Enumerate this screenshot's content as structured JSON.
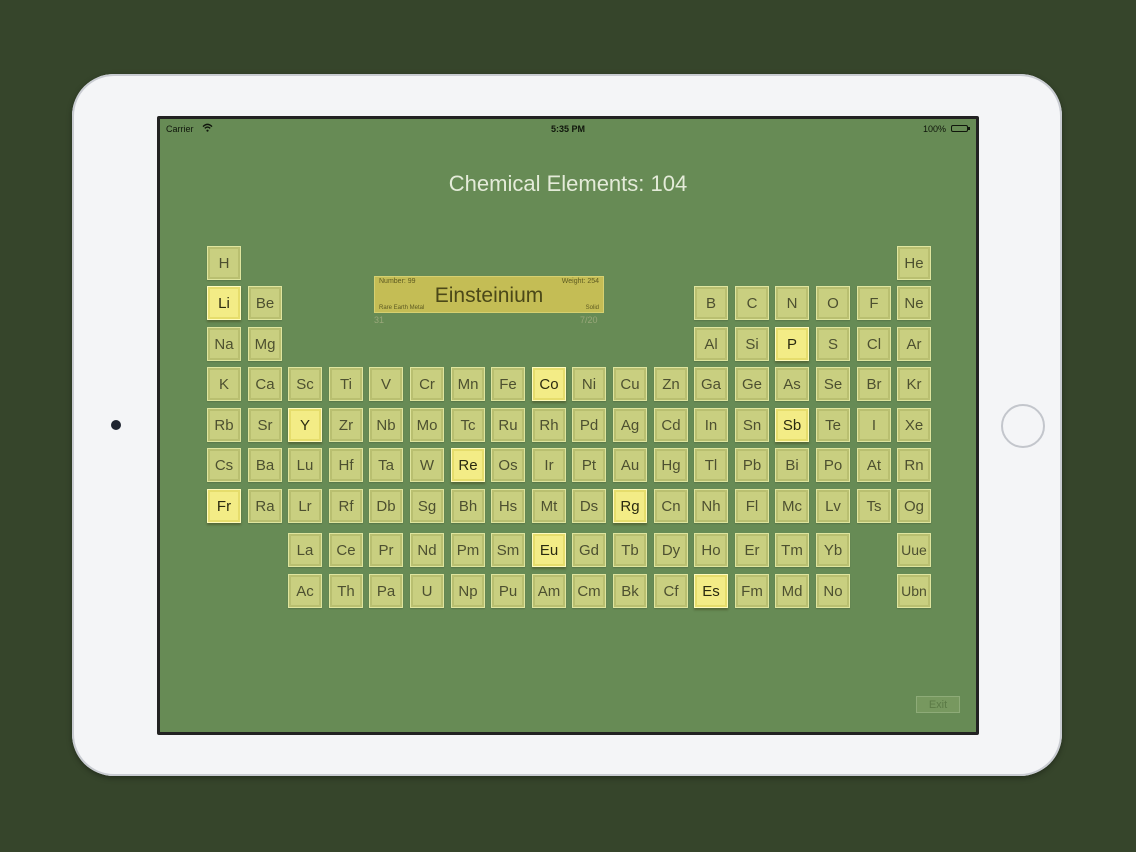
{
  "status_bar": {
    "carrier": "Carrier",
    "time": "5:35 PM",
    "battery": "100%"
  },
  "title": "Chemical Elements: 104",
  "info_card": {
    "number": "Number: 99",
    "weight": "Weight: 254",
    "name": "Einsteinium",
    "category": "Rare Earth Metal",
    "state": "Solid",
    "left_count": "31",
    "right_count": "7/20"
  },
  "exit_label": "Exit",
  "colors": {
    "background": "#678b55",
    "tile": "#c9cf80",
    "tile_highlight": "#f3ec86"
  },
  "elements": [
    {
      "s": "H",
      "r": 0,
      "c": 0
    },
    {
      "s": "He",
      "r": 0,
      "c": 17
    },
    {
      "s": "Li",
      "r": 1,
      "c": 0,
      "hl": true
    },
    {
      "s": "Be",
      "r": 1,
      "c": 1
    },
    {
      "s": "B",
      "r": 1,
      "c": 12
    },
    {
      "s": "C",
      "r": 1,
      "c": 13
    },
    {
      "s": "N",
      "r": 1,
      "c": 14
    },
    {
      "s": "O",
      "r": 1,
      "c": 15
    },
    {
      "s": "F",
      "r": 1,
      "c": 16
    },
    {
      "s": "Ne",
      "r": 1,
      "c": 17
    },
    {
      "s": "Na",
      "r": 2,
      "c": 0
    },
    {
      "s": "Mg",
      "r": 2,
      "c": 1
    },
    {
      "s": "Al",
      "r": 2,
      "c": 12
    },
    {
      "s": "Si",
      "r": 2,
      "c": 13
    },
    {
      "s": "P",
      "r": 2,
      "c": 14,
      "hl": true
    },
    {
      "s": "S",
      "r": 2,
      "c": 15
    },
    {
      "s": "Cl",
      "r": 2,
      "c": 16
    },
    {
      "s": "Ar",
      "r": 2,
      "c": 17
    },
    {
      "s": "K",
      "r": 3,
      "c": 0
    },
    {
      "s": "Ca",
      "r": 3,
      "c": 1
    },
    {
      "s": "Sc",
      "r": 3,
      "c": 2
    },
    {
      "s": "Ti",
      "r": 3,
      "c": 3
    },
    {
      "s": "V",
      "r": 3,
      "c": 4
    },
    {
      "s": "Cr",
      "r": 3,
      "c": 5
    },
    {
      "s": "Mn",
      "r": 3,
      "c": 6
    },
    {
      "s": "Fe",
      "r": 3,
      "c": 7
    },
    {
      "s": "Co",
      "r": 3,
      "c": 8,
      "hl": true
    },
    {
      "s": "Ni",
      "r": 3,
      "c": 9
    },
    {
      "s": "Cu",
      "r": 3,
      "c": 10
    },
    {
      "s": "Zn",
      "r": 3,
      "c": 11
    },
    {
      "s": "Ga",
      "r": 3,
      "c": 12
    },
    {
      "s": "Ge",
      "r": 3,
      "c": 13
    },
    {
      "s": "As",
      "r": 3,
      "c": 14
    },
    {
      "s": "Se",
      "r": 3,
      "c": 15
    },
    {
      "s": "Br",
      "r": 3,
      "c": 16
    },
    {
      "s": "Kr",
      "r": 3,
      "c": 17
    },
    {
      "s": "Rb",
      "r": 4,
      "c": 0
    },
    {
      "s": "Sr",
      "r": 4,
      "c": 1
    },
    {
      "s": "Y",
      "r": 4,
      "c": 2,
      "hl": true
    },
    {
      "s": "Zr",
      "r": 4,
      "c": 3
    },
    {
      "s": "Nb",
      "r": 4,
      "c": 4
    },
    {
      "s": "Mo",
      "r": 4,
      "c": 5
    },
    {
      "s": "Tc",
      "r": 4,
      "c": 6
    },
    {
      "s": "Ru",
      "r": 4,
      "c": 7
    },
    {
      "s": "Rh",
      "r": 4,
      "c": 8
    },
    {
      "s": "Pd",
      "r": 4,
      "c": 9
    },
    {
      "s": "Ag",
      "r": 4,
      "c": 10
    },
    {
      "s": "Cd",
      "r": 4,
      "c": 11
    },
    {
      "s": "In",
      "r": 4,
      "c": 12
    },
    {
      "s": "Sn",
      "r": 4,
      "c": 13
    },
    {
      "s": "Sb",
      "r": 4,
      "c": 14,
      "hl": true
    },
    {
      "s": "Te",
      "r": 4,
      "c": 15
    },
    {
      "s": "I",
      "r": 4,
      "c": 16
    },
    {
      "s": "Xe",
      "r": 4,
      "c": 17
    },
    {
      "s": "Cs",
      "r": 5,
      "c": 0
    },
    {
      "s": "Ba",
      "r": 5,
      "c": 1
    },
    {
      "s": "Lu",
      "r": 5,
      "c": 2
    },
    {
      "s": "Hf",
      "r": 5,
      "c": 3
    },
    {
      "s": "Ta",
      "r": 5,
      "c": 4
    },
    {
      "s": "W",
      "r": 5,
      "c": 5
    },
    {
      "s": "Re",
      "r": 5,
      "c": 6,
      "hl": true
    },
    {
      "s": "Os",
      "r": 5,
      "c": 7
    },
    {
      "s": "Ir",
      "r": 5,
      "c": 8
    },
    {
      "s": "Pt",
      "r": 5,
      "c": 9
    },
    {
      "s": "Au",
      "r": 5,
      "c": 10
    },
    {
      "s": "Hg",
      "r": 5,
      "c": 11
    },
    {
      "s": "Tl",
      "r": 5,
      "c": 12
    },
    {
      "s": "Pb",
      "r": 5,
      "c": 13
    },
    {
      "s": "Bi",
      "r": 5,
      "c": 14
    },
    {
      "s": "Po",
      "r": 5,
      "c": 15
    },
    {
      "s": "At",
      "r": 5,
      "c": 16
    },
    {
      "s": "Rn",
      "r": 5,
      "c": 17
    },
    {
      "s": "Fr",
      "r": 6,
      "c": 0,
      "hl": true
    },
    {
      "s": "Ra",
      "r": 6,
      "c": 1
    },
    {
      "s": "Lr",
      "r": 6,
      "c": 2
    },
    {
      "s": "Rf",
      "r": 6,
      "c": 3
    },
    {
      "s": "Db",
      "r": 6,
      "c": 4
    },
    {
      "s": "Sg",
      "r": 6,
      "c": 5
    },
    {
      "s": "Bh",
      "r": 6,
      "c": 6
    },
    {
      "s": "Hs",
      "r": 6,
      "c": 7
    },
    {
      "s": "Mt",
      "r": 6,
      "c": 8
    },
    {
      "s": "Ds",
      "r": 6,
      "c": 9
    },
    {
      "s": "Rg",
      "r": 6,
      "c": 10,
      "hl": true
    },
    {
      "s": "Cn",
      "r": 6,
      "c": 11
    },
    {
      "s": "Nh",
      "r": 6,
      "c": 12
    },
    {
      "s": "Fl",
      "r": 6,
      "c": 13
    },
    {
      "s": "Mc",
      "r": 6,
      "c": 14
    },
    {
      "s": "Lv",
      "r": 6,
      "c": 15
    },
    {
      "s": "Ts",
      "r": 6,
      "c": 16
    },
    {
      "s": "Og",
      "r": 6,
      "c": 17
    },
    {
      "s": "La",
      "r": 7,
      "c": 2
    },
    {
      "s": "Ce",
      "r": 7,
      "c": 3
    },
    {
      "s": "Pr",
      "r": 7,
      "c": 4
    },
    {
      "s": "Nd",
      "r": 7,
      "c": 5
    },
    {
      "s": "Pm",
      "r": 7,
      "c": 6
    },
    {
      "s": "Sm",
      "r": 7,
      "c": 7
    },
    {
      "s": "Eu",
      "r": 7,
      "c": 8,
      "hl": true
    },
    {
      "s": "Gd",
      "r": 7,
      "c": 9
    },
    {
      "s": "Tb",
      "r": 7,
      "c": 10
    },
    {
      "s": "Dy",
      "r": 7,
      "c": 11
    },
    {
      "s": "Ho",
      "r": 7,
      "c": 12
    },
    {
      "s": "Er",
      "r": 7,
      "c": 13
    },
    {
      "s": "Tm",
      "r": 7,
      "c": 14
    },
    {
      "s": "Yb",
      "r": 7,
      "c": 15
    },
    {
      "s": "Uue",
      "r": 7,
      "c": 17
    },
    {
      "s": "Ac",
      "r": 8,
      "c": 2
    },
    {
      "s": "Th",
      "r": 8,
      "c": 3
    },
    {
      "s": "Pa",
      "r": 8,
      "c": 4
    },
    {
      "s": "U",
      "r": 8,
      "c": 5
    },
    {
      "s": "Np",
      "r": 8,
      "c": 6
    },
    {
      "s": "Pu",
      "r": 8,
      "c": 7
    },
    {
      "s": "Am",
      "r": 8,
      "c": 8
    },
    {
      "s": "Cm",
      "r": 8,
      "c": 9
    },
    {
      "s": "Bk",
      "r": 8,
      "c": 10
    },
    {
      "s": "Cf",
      "r": 8,
      "c": 11
    },
    {
      "s": "Es",
      "r": 8,
      "c": 12,
      "hl": true
    },
    {
      "s": "Fm",
      "r": 8,
      "c": 13
    },
    {
      "s": "Md",
      "r": 8,
      "c": 14
    },
    {
      "s": "No",
      "r": 8,
      "c": 15
    },
    {
      "s": "Ubn",
      "r": 8,
      "c": 17
    }
  ]
}
